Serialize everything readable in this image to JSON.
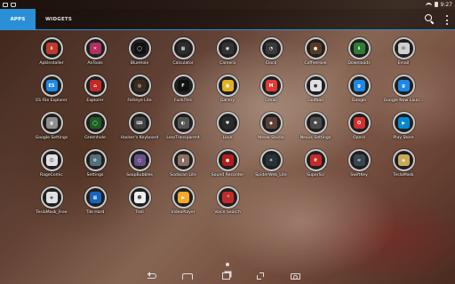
{
  "status_bar": {
    "time": "9:27"
  },
  "tabs": [
    {
      "label": "APPS",
      "active": true
    },
    {
      "label": "WIDGETS",
      "active": false
    }
  ],
  "accent_color": "#2a8fd6",
  "apps": [
    {
      "label": "ApkInstaller",
      "icon": "apk-installer-icon",
      "color": "#c0392b",
      "glyph": "⬇"
    },
    {
      "label": "AnTools",
      "icon": "antools-icon",
      "color": "#b03060",
      "glyph": "✕"
    },
    {
      "label": "BlueHole",
      "icon": "bluehole-icon",
      "color": "#111111",
      "glyph": "◯"
    },
    {
      "label": "Calculator",
      "icon": "calculator-icon",
      "color": "#2d2d2d",
      "glyph": "▦"
    },
    {
      "label": "Camera",
      "icon": "camera-icon",
      "color": "#333333",
      "glyph": "◉"
    },
    {
      "label": "Clock",
      "icon": "clock-icon",
      "color": "#3a3a3a",
      "glyph": "◔"
    },
    {
      "label": "CoffeeHole",
      "icon": "coffeehole-icon",
      "color": "#5a3a22",
      "glyph": "●"
    },
    {
      "label": "Downloads",
      "icon": "downloads-icon",
      "color": "#2e7d32",
      "glyph": "⬇"
    },
    {
      "label": "Email",
      "icon": "email-icon",
      "color": "#cfcfcf",
      "glyph": "✉"
    },
    {
      "label": "ES File Explorer",
      "icon": "es-file-explorer-icon",
      "color": "#1e88e5",
      "glyph": "ES"
    },
    {
      "label": "Explorer",
      "icon": "explorer-icon",
      "color": "#c62828",
      "glyph": "⌂"
    },
    {
      "label": "Fisheye Lite",
      "icon": "fisheye-lite-icon",
      "color": "#3c2a1e",
      "glyph": "◎"
    },
    {
      "label": "FuckThis",
      "icon": "fuckthis-icon",
      "color": "#111111",
      "glyph": "F"
    },
    {
      "label": "Gallery",
      "icon": "gallery-icon",
      "color": "#e0b020",
      "glyph": "▣"
    },
    {
      "label": "Gmail",
      "icon": "gmail-icon",
      "color": "#e53935",
      "glyph": "M"
    },
    {
      "label": "Golfball",
      "icon": "golfball-icon",
      "color": "#e0e0e0",
      "glyph": "●"
    },
    {
      "label": "Google",
      "icon": "google-icon",
      "color": "#1e88e5",
      "glyph": "g"
    },
    {
      "label": "Google Now Laun...",
      "icon": "google-now-launcher-icon",
      "color": "#1e88e5",
      "glyph": "g"
    },
    {
      "label": "Google Settings",
      "icon": "google-settings-icon",
      "color": "#8e8e8e",
      "glyph": "g"
    },
    {
      "label": "Greenhole",
      "icon": "greenhole-icon",
      "color": "#1b5e20",
      "glyph": "◯"
    },
    {
      "label": "Hacker's Keyboard",
      "icon": "hackers-keyboard-icon",
      "color": "#424242",
      "glyph": "⌨"
    },
    {
      "label": "LessTransparent",
      "icon": "lesstransparent-icon",
      "color": "#555555",
      "glyph": "◐"
    },
    {
      "label": "Love",
      "icon": "love-icon",
      "color": "#2b2b2b",
      "glyph": "♥"
    },
    {
      "label": "Meow Studio",
      "icon": "meow-studio-icon",
      "color": "#5d4037",
      "glyph": "◆"
    },
    {
      "label": "Nexus Settings",
      "icon": "nexus-settings-icon",
      "color": "#4a4a4a",
      "glyph": "✱"
    },
    {
      "label": "Opera",
      "icon": "opera-icon",
      "color": "#d32f2f",
      "glyph": "O"
    },
    {
      "label": "Play Store",
      "icon": "play-store-icon",
      "color": "#0288d1",
      "glyph": "▶"
    },
    {
      "label": "RageComic",
      "icon": "ragecomic-icon",
      "color": "#e0e0e0",
      "glyph": "☺"
    },
    {
      "label": "Settings",
      "icon": "settings-icon",
      "color": "#546e7a",
      "glyph": "⚙"
    },
    {
      "label": "SoapBubbles",
      "icon": "soapbubbles-icon",
      "color": "#6a4f8a",
      "glyph": "○"
    },
    {
      "label": "Sodacan Lite",
      "icon": "sodacan-lite-icon",
      "color": "#8d6e63",
      "glyph": "▮"
    },
    {
      "label": "Sound Recorder",
      "icon": "sound-recorder-icon",
      "color": "#b71c1c",
      "glyph": "●"
    },
    {
      "label": "SpiderWeb_Lite",
      "icon": "spiderweb-lite-icon",
      "color": "#263238",
      "glyph": "✳"
    },
    {
      "label": "SuperSU",
      "icon": "supersu-icon",
      "color": "#c62828",
      "glyph": "#"
    },
    {
      "label": "SwiftKey",
      "icon": "swiftkey-icon",
      "color": "#37474f",
      "glyph": "≈"
    },
    {
      "label": "TeslaMask",
      "icon": "teslamask-icon",
      "color": "#c9a85a",
      "glyph": "◈"
    },
    {
      "label": "TeslaMask_Free",
      "icon": "teslamask-free-icon",
      "color": "#e0e0e0",
      "glyph": "◈"
    },
    {
      "label": "Tile Hard",
      "icon": "tile-hard-icon",
      "color": "#1565c0",
      "glyph": "▦"
    },
    {
      "label": "Troll",
      "icon": "troll-icon",
      "color": "#eeeeee",
      "glyph": "☻"
    },
    {
      "label": "VideoPlayer",
      "icon": "videoplayer-icon",
      "color": "#f9a825",
      "glyph": "▶"
    },
    {
      "label": "Voice Search",
      "icon": "voice-search-icon",
      "color": "#c62828",
      "glyph": "🎤"
    }
  ],
  "nav": [
    "back-icon",
    "home-icon",
    "recent-apps-icon",
    "expand-icon",
    "camera-shortcut-icon"
  ]
}
